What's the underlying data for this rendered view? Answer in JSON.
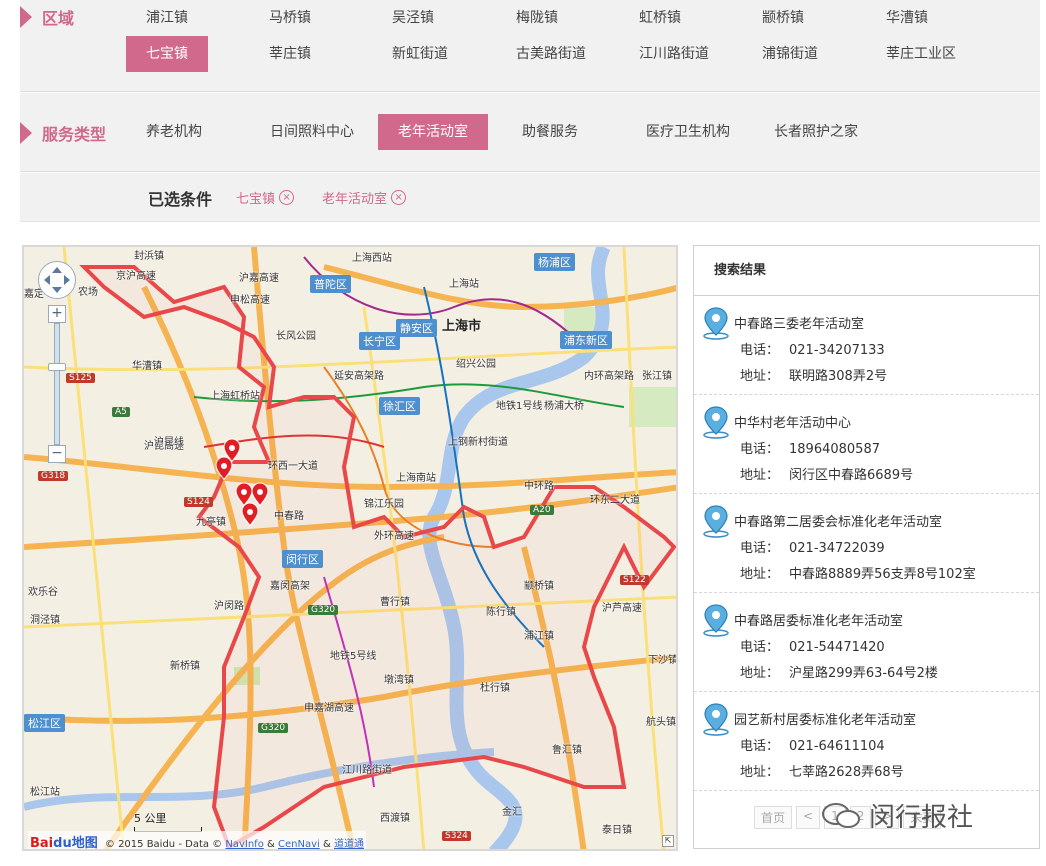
{
  "filters": {
    "region": {
      "title": "区域",
      "options": [
        "浦江镇",
        "马桥镇",
        "吴泾镇",
        "梅陇镇",
        "虹桥镇",
        "颛桥镇",
        "华漕镇",
        "七宝镇",
        "莘庄镇",
        "新虹街道",
        "古美路街道",
        "江川路街道",
        "浦锦街道",
        "莘庄工业区"
      ],
      "selected": "七宝镇"
    },
    "service": {
      "title": "服务类型",
      "options": [
        "养老机构",
        "日间照料中心",
        "老年活动室",
        "助餐服务",
        "医疗卫生机构",
        "长者照护之家"
      ],
      "selected": "老年活动室"
    },
    "chosen": {
      "label": "已选条件",
      "chips": [
        "七宝镇",
        "老年活动室"
      ],
      "remove_glyph": "×"
    }
  },
  "map": {
    "districts": [
      "普陀区",
      "长宁区",
      "静安区",
      "杨浦区",
      "浦东新区",
      "徐汇区",
      "闵行区",
      "松江区"
    ],
    "city_label": "上海市",
    "labels": [
      "封浜镇",
      "京沪高速",
      "嘉定",
      "沪嘉高速",
      "申松高速",
      "农场",
      "华漕镇",
      "上海西站",
      "上海站",
      "长风公园",
      "绍兴公园",
      "上海虹桥站",
      "延安高架路",
      "上海南站",
      "上钢新村街道",
      "锦江乐园",
      "外环高速",
      "环西一大道",
      "九亭镇",
      "沪昆高速",
      "嘉闵高架",
      "新桥镇",
      "曹行镇",
      "陈行镇",
      "颛桥镇",
      "浦江镇",
      "杜行镇",
      "墩湾镇",
      "申嘉湖高速",
      "江川路街道",
      "西渡镇",
      "金汇",
      "鲁汇镇",
      "泰日镇",
      "沪芦高速",
      "下沙镇",
      "航头镇",
      "中环路",
      "环东二大道",
      "内环高架路",
      "杨浦大桥",
      "张江镇",
      "欢乐谷",
      "洞泾镇",
      "沪昆线",
      "松江站",
      "地铁5号线",
      "中春路",
      "沪闵路",
      "地铁1号线"
    ],
    "road_signs_red": [
      "S125",
      "G318",
      "S124",
      "S122",
      "S324"
    ],
    "road_signs_green": [
      "A20",
      "A5",
      "G320",
      "G320"
    ],
    "scale_label": "5 公里",
    "copyright_text": "© 2015 Baidu - Data ©",
    "copyright_link1": "NavInfo",
    "copyright_amp": "&",
    "copyright_link2": "CenNavi",
    "copyright_link3": "道道通",
    "logo_text_1": "Bai",
    "logo_text_2": "du地图",
    "zoom_in": "+",
    "zoom_out": "−",
    "corner_glyph": "⇱"
  },
  "results": {
    "title": "搜索结果",
    "phone_key": "电话：",
    "addr_key": "地址：",
    "items": [
      {
        "name": "中春路三委老年活动室",
        "phone": "021-34207133",
        "address": "联明路308弄2号"
      },
      {
        "name": "中华村老年活动中心",
        "phone": "18964080587",
        "address": "闵行区中春路6689号"
      },
      {
        "name": "中春路第二居委会标准化老年活动室",
        "phone": "021-34722039",
        "address": "中春路8889弄56支弄8号102室"
      },
      {
        "name": "中春路居委标准化老年活动室",
        "phone": "021-54471420",
        "address": "沪星路299弄63-64号2楼"
      },
      {
        "name": "园艺新村居委标准化老年活动室",
        "phone": "021-64611104",
        "address": "七莘路2628弄68号"
      }
    ],
    "pager": [
      "首页",
      "<",
      "1",
      "2",
      ">",
      "末页"
    ],
    "watermark": "闵行报社"
  },
  "colors": {
    "accent": "#d0698c",
    "district_tag": "#4e8fd0",
    "boundary": "#e8484a",
    "pin": "#e01e24"
  }
}
